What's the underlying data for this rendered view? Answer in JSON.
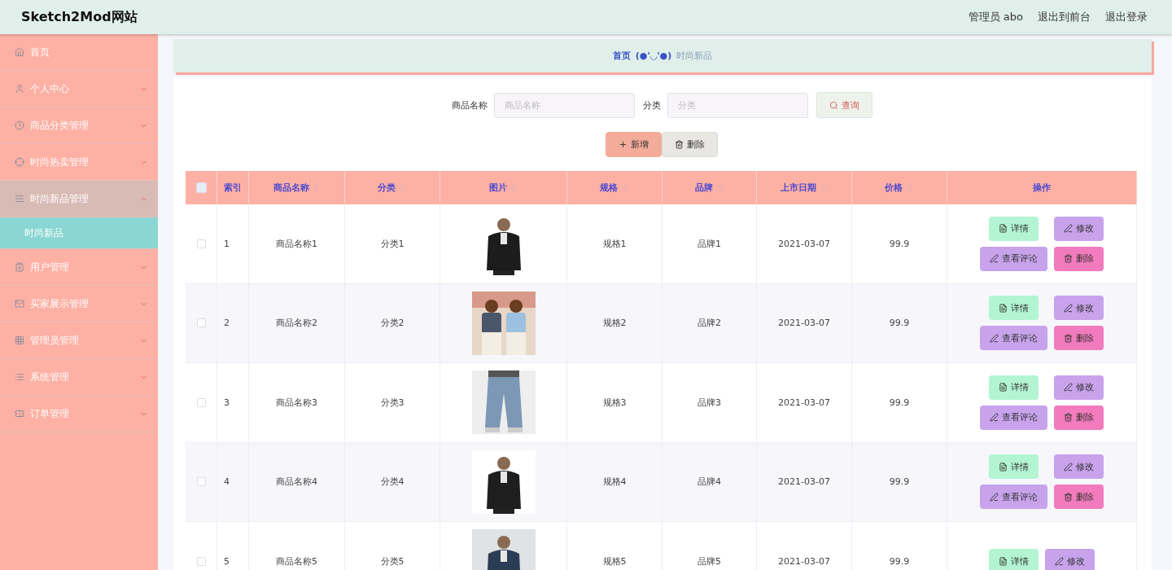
{
  "header": {
    "title": "Sketch2Mod网站",
    "links": [
      "管理员 abo",
      "退出到前台",
      "退出登录"
    ]
  },
  "sidebar": {
    "items": [
      {
        "label": "首页",
        "kind": "link",
        "expanded": false
      },
      {
        "label": "个人中心",
        "kind": "menu",
        "expanded": false
      },
      {
        "label": "商品分类管理",
        "kind": "menu",
        "expanded": false
      },
      {
        "label": "时尚热卖管理",
        "kind": "menu",
        "expanded": false
      },
      {
        "label": "时尚新品管理",
        "kind": "menu",
        "expanded": true,
        "children": [
          {
            "label": "时尚新品",
            "selected": true
          }
        ]
      },
      {
        "label": "用户管理",
        "kind": "menu",
        "expanded": false
      },
      {
        "label": "买家展示管理",
        "kind": "menu",
        "expanded": false
      },
      {
        "label": "管理员管理",
        "kind": "menu",
        "expanded": false
      },
      {
        "label": "系统管理",
        "kind": "menu",
        "expanded": false
      },
      {
        "label": "订单管理",
        "kind": "menu",
        "expanded": false
      }
    ]
  },
  "breadcrumb": {
    "home": "首页",
    "separator": "(●'◡'●)",
    "current": "时尚新品"
  },
  "search": {
    "fields": [
      {
        "label": "商品名称",
        "placeholder": "商品名称"
      },
      {
        "label": "分类",
        "placeholder": "分类"
      }
    ],
    "button": "查询"
  },
  "actions": [
    {
      "label": "新增",
      "kind": "add"
    },
    {
      "label": "删除",
      "kind": "delete"
    }
  ],
  "table": {
    "select_all_checked": false,
    "columns": [
      {
        "label": "索引",
        "sortable": false
      },
      {
        "label": "商品名称",
        "sortable": true
      },
      {
        "label": "分类",
        "sortable": true
      },
      {
        "label": "图片",
        "sortable": true
      },
      {
        "label": "规格",
        "sortable": true
      },
      {
        "label": "品牌",
        "sortable": true
      },
      {
        "label": "上市日期",
        "sortable": true
      },
      {
        "label": "价格",
        "sortable": true
      },
      {
        "label": "操作",
        "sortable": false
      }
    ],
    "rows": [
      {
        "checked": false,
        "cells": [
          "1",
          "商品名称1",
          "分类1",
          null,
          "规格1",
          "品牌1",
          "2021-03-07",
          "99.9"
        ],
        "image": {
          "kind": "picture"
        },
        "buttons": [
          {
            "label": "详情",
            "kind": "detail"
          },
          {
            "label": "修改",
            "kind": "edit"
          },
          {
            "label": "查看评论",
            "kind": "comments"
          },
          {
            "label": "删除",
            "kind": "delete"
          }
        ]
      },
      {
        "checked": false,
        "cells": [
          "2",
          "商品名称2",
          "分类2",
          null,
          "规格2",
          "品牌2",
          "2021-03-07",
          "99.9"
        ],
        "image": {
          "kind": "picture"
        },
        "buttons": [
          {
            "label": "详情",
            "kind": "detail"
          },
          {
            "label": "修改",
            "kind": "edit"
          },
          {
            "label": "查看评论",
            "kind": "comments"
          },
          {
            "label": "删除",
            "kind": "delete"
          }
        ]
      },
      {
        "checked": false,
        "cells": [
          "3",
          "商品名称3",
          "分类3",
          null,
          "规格3",
          "品牌3",
          "2021-03-07",
          "99.9"
        ],
        "image": {
          "kind": "picture"
        },
        "buttons": [
          {
            "label": "详情",
            "kind": "detail"
          },
          {
            "label": "修改",
            "kind": "edit"
          },
          {
            "label": "查看评论",
            "kind": "comments"
          },
          {
            "label": "删除",
            "kind": "delete"
          }
        ]
      },
      {
        "checked": false,
        "cells": [
          "4",
          "商品名称4",
          "分类4",
          null,
          "规格4",
          "品牌4",
          "2021-03-07",
          "99.9"
        ],
        "image": {
          "kind": "picture"
        },
        "buttons": [
          {
            "label": "详情",
            "kind": "detail"
          },
          {
            "label": "修改",
            "kind": "edit"
          },
          {
            "label": "查看评论",
            "kind": "comments"
          },
          {
            "label": "删除",
            "kind": "delete"
          }
        ]
      },
      {
        "checked": false,
        "cells": [
          "5",
          "商品名称5",
          "分类5",
          null,
          "规格5",
          "品牌5",
          "2021-03-07",
          "99.9"
        ],
        "image": {
          "kind": "picture"
        },
        "buttons": [
          {
            "label": "详情",
            "kind": "detail"
          },
          {
            "label": "修改",
            "kind": "edit"
          }
        ]
      }
    ]
  }
}
